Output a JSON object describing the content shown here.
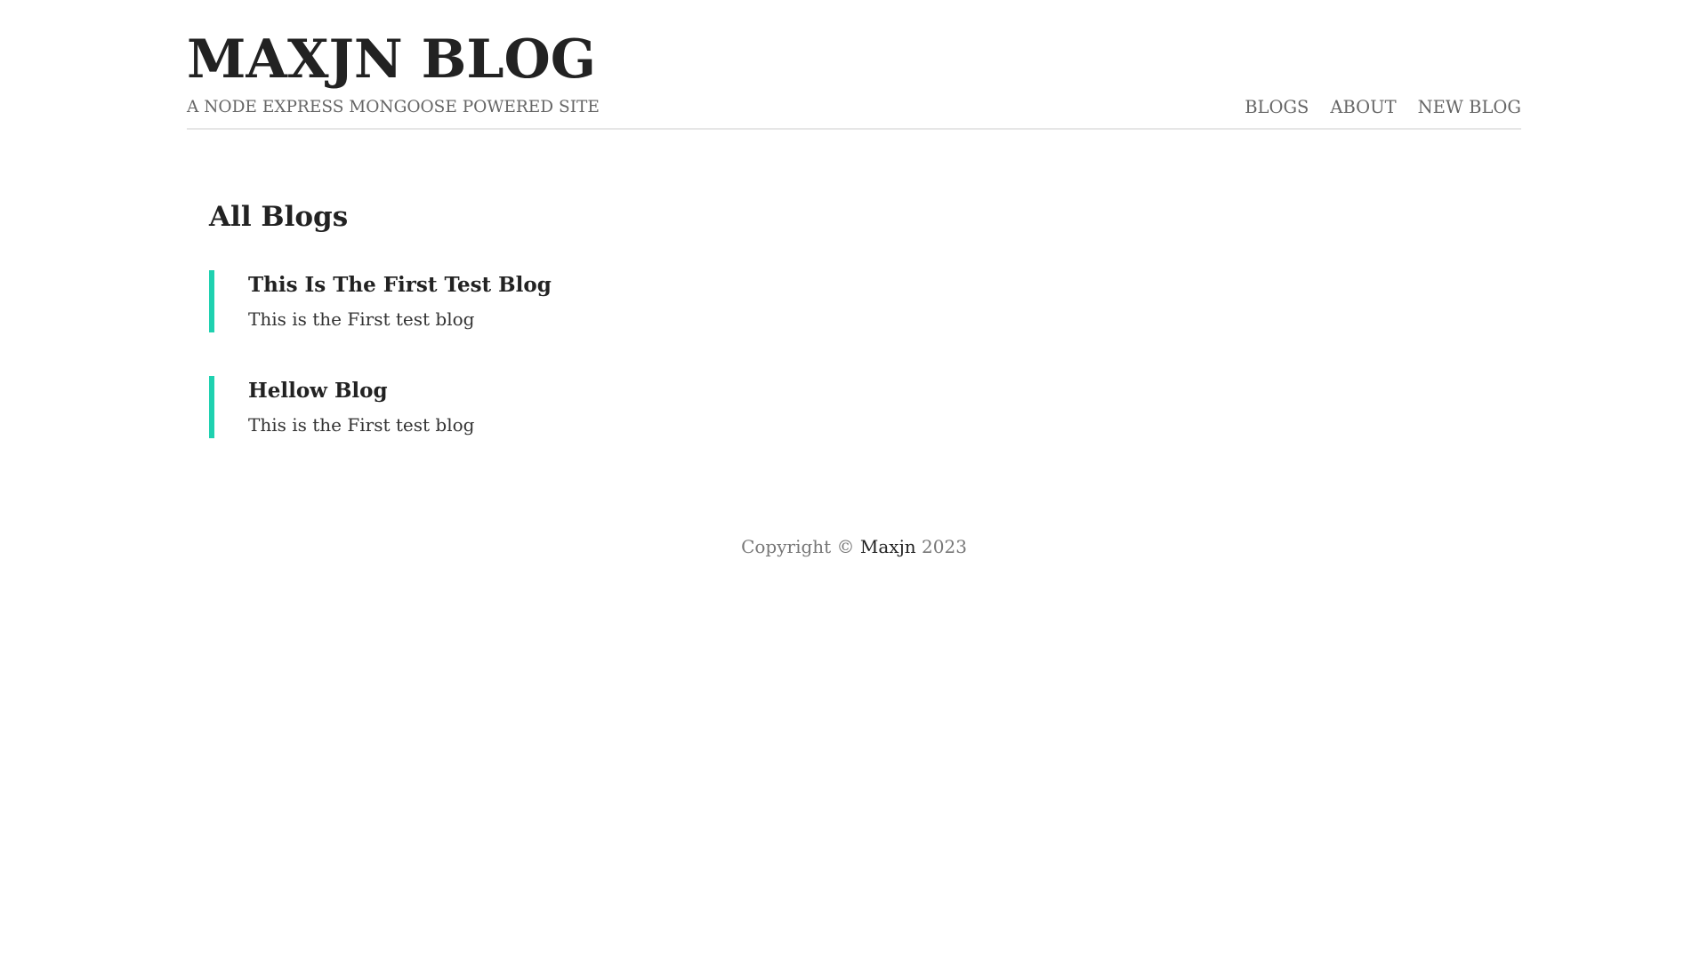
{
  "header": {
    "title": "MAXJN BLOG",
    "tagline": "A NODE EXPRESS MONGOOSE POWERED SITE",
    "nav": [
      {
        "label": "BLOGS"
      },
      {
        "label": "ABOUT"
      },
      {
        "label": "NEW BLOG"
      }
    ]
  },
  "main": {
    "section_title": "All Blogs",
    "blogs": [
      {
        "title": "This Is The First Test Blog",
        "snippet": "This is the First test blog"
      },
      {
        "title": "Hellow Blog",
        "snippet": "This is the First test blog"
      }
    ]
  },
  "footer": {
    "copyright_prefix": "Copyright ©",
    "author_link": "Maxjn",
    "year": "2023"
  },
  "colors": {
    "accent": "#1fd1b0",
    "text_primary": "#222222",
    "text_muted": "#666666",
    "divider": "#e6e6e6"
  }
}
